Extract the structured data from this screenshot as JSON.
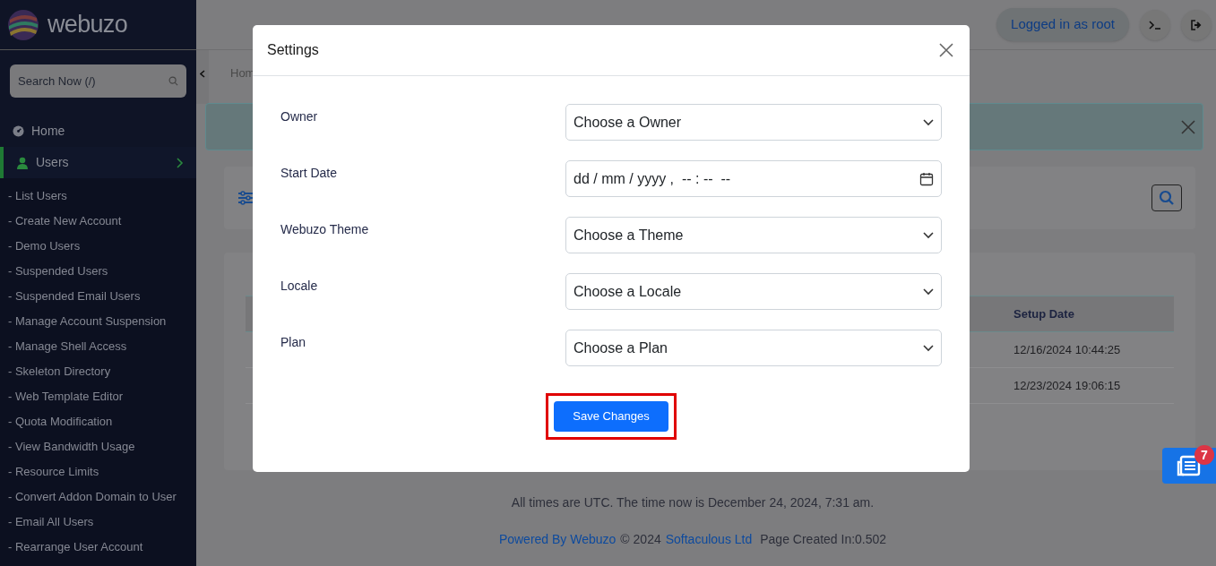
{
  "sidebar": {
    "logo": "webuzo",
    "search": {
      "placeholder": "Search Now (/)"
    },
    "items": [
      {
        "label": "Home",
        "kind": "home",
        "selected": false
      },
      {
        "label": "Users",
        "kind": "users",
        "selected": true,
        "expanded": true,
        "children": [
          {
            "label": "- List Users"
          },
          {
            "label": "- Create New Account"
          },
          {
            "label": "- Demo Users"
          },
          {
            "label": "- Suspended Users"
          },
          {
            "label": "- Suspended Email Users"
          },
          {
            "label": "- Manage Account Suspension"
          },
          {
            "label": "- Manage Shell Access"
          },
          {
            "label": "- Skeleton Directory"
          },
          {
            "label": "- Web Template Editor"
          },
          {
            "label": "- Quota Modification"
          },
          {
            "label": "- View Bandwidth Usage"
          },
          {
            "label": "- Resource Limits"
          },
          {
            "label": "- Convert Addon Domain to User"
          },
          {
            "label": "- Email All Users"
          },
          {
            "label": "- Rearrange User Account"
          }
        ]
      }
    ]
  },
  "header": {
    "user_button": "Logged in as root"
  },
  "main": {
    "breadcrumb": "Hom",
    "table": {
      "columns": [
        "Setup Date"
      ],
      "rows": [
        [
          "12/16/2024 10:44:25"
        ],
        [
          "12/23/2024 19:06:15"
        ]
      ]
    }
  },
  "footer": {
    "time": "All times are UTC. The time now is December 24, 2024, 7:31 am.",
    "powered": "Powered By Webuzo",
    "copyright": "© 2024",
    "company": "Softaculous Ltd",
    "created": "Page Created In:0.502"
  },
  "news": {
    "count": "7"
  },
  "modal": {
    "title": "Settings",
    "fields": [
      {
        "label": "Owner",
        "kind": "select",
        "value": "Choose a Owner"
      },
      {
        "label": "Start Date",
        "kind": "datetime",
        "value": "dd / mm / yyyy ,  -- : --  --"
      },
      {
        "label": "Webuzo Theme",
        "kind": "select",
        "value": "Choose a Theme"
      },
      {
        "label": "Locale",
        "kind": "select",
        "value": "Choose a Locale"
      },
      {
        "label": "Plan",
        "kind": "select",
        "value": "Choose a Plan"
      }
    ],
    "button": {
      "label": "Save Changes",
      "highlighted": true
    }
  }
}
